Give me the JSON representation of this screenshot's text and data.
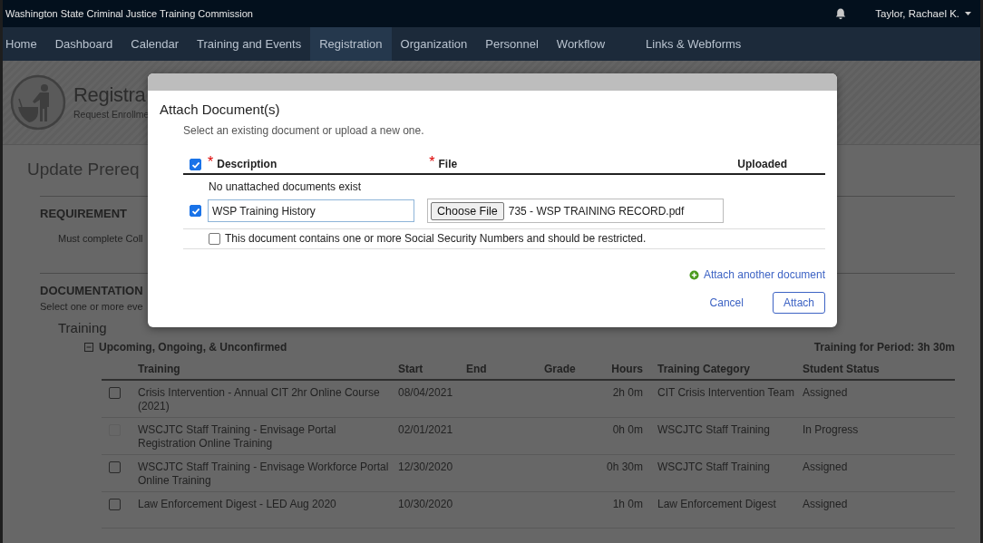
{
  "app_bar": {
    "title": "Washington State Criminal Justice Training Commission",
    "user_name": "Taylor, Rachael K."
  },
  "nav": [
    {
      "label": "Home",
      "selected": false
    },
    {
      "label": "Dashboard",
      "selected": false
    },
    {
      "label": "Calendar",
      "selected": false
    },
    {
      "label": "Training and Events",
      "selected": false
    },
    {
      "label": "Registration",
      "selected": true
    },
    {
      "label": "Organization",
      "selected": false
    },
    {
      "label": "Personnel",
      "selected": false
    },
    {
      "label": "Workflow",
      "selected": false
    },
    {
      "label": "Links & Webforms",
      "selected": false
    }
  ],
  "page_header": {
    "title": "Registra",
    "subtitle": "Request Enrollme"
  },
  "page_title": "Update Prereq",
  "sections": [
    {
      "heading": "REQUIREMENT",
      "text": "Must complete Coll",
      "kind": "indented"
    },
    {
      "heading": "DOCUMENTATION",
      "text": "Select one or more eve",
      "kind": "flush"
    }
  ],
  "training": {
    "heading": "Training",
    "group": {
      "label": "Upcoming, Ongoing, & Unconfirmed",
      "expanded": true
    },
    "period_total": "Training for Period: 3h 30m",
    "columns": [
      "Training",
      "Start",
      "End",
      "Grade",
      "Hours",
      "Training Category",
      "Student Status"
    ],
    "rows": [
      {
        "checked": false,
        "disabled": false,
        "training": "Crisis Intervention - Annual CIT 2hr Online Course (2021)",
        "start": "08/04/2021",
        "hours": "2h 0m",
        "category": "CIT Crisis Intervention Team",
        "status": "Assigned"
      },
      {
        "checked": false,
        "disabled": true,
        "training": "WSCJTC Staff Training - Envisage Portal Registration Online Training",
        "start": "02/01/2021",
        "hours": "0h 0m",
        "category": "WSCJTC Staff Training",
        "status": "In Progress"
      },
      {
        "checked": false,
        "disabled": false,
        "training": "WSCJTC Staff Training - Envisage Workforce Portal Online Training",
        "start": "12/30/2020",
        "hours": "0h 30m",
        "category": "WSCJTC Staff Training",
        "status": "Assigned"
      },
      {
        "checked": false,
        "disabled": false,
        "training": "Law Enforcement Digest - LED Aug 2020",
        "start": "10/30/2020",
        "hours": "1h 0m",
        "category": "Law Enforcement Digest",
        "status": "Assigned"
      }
    ]
  },
  "dialog": {
    "title": "Attach Document(s)",
    "instruction": "Select an existing document or upload a new one.",
    "select_all_checked": true,
    "columns": [
      {
        "label": "Description",
        "required_mark": "*"
      },
      {
        "label": "File",
        "required_mark": "*"
      },
      {
        "label": "Uploaded"
      }
    ],
    "empty_message": "No unattached documents exist",
    "documents": [
      {
        "checked": true,
        "description": "WSP Training History",
        "choose_label": "Choose File",
        "file_name": "735 - WSP TRAINING RECORD.pdf",
        "restricted": false,
        "restricted_label": "This document contains one or more Social Security Numbers and should be restricted."
      }
    ],
    "add_link": "Attach another document",
    "buttons": [
      {
        "label": "Cancel",
        "kind": "link"
      },
      {
        "label": "Attach",
        "kind": "outline"
      }
    ]
  }
}
